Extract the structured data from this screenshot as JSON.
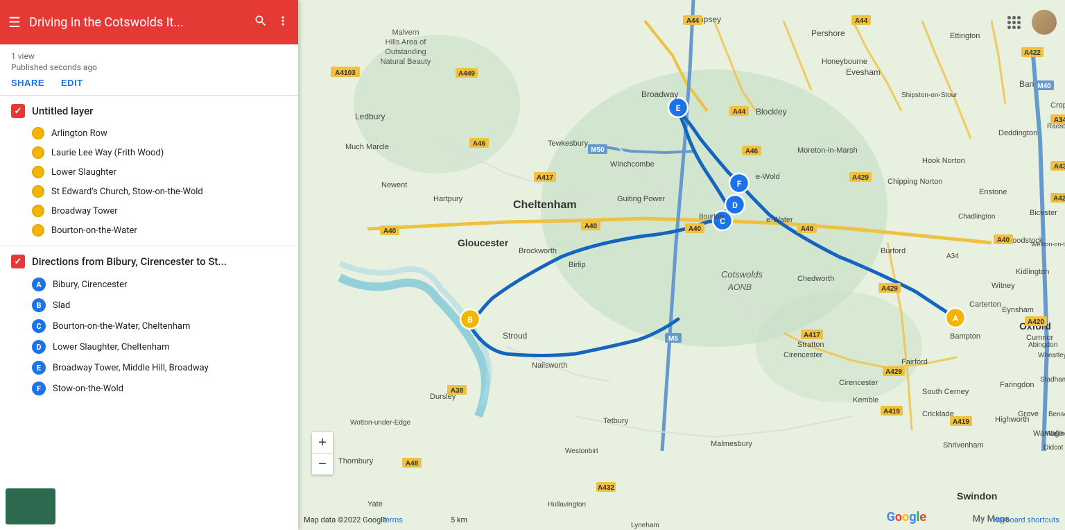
{
  "header": {
    "title": "Driving in the Cotswolds It...",
    "menu_icon": "☰",
    "search_icon": "🔍",
    "more_icon": "⋮"
  },
  "meta": {
    "views": "1 view",
    "published": "Published seconds ago",
    "share_label": "SHARE",
    "edit_label": "EDIT"
  },
  "layer": {
    "title": "Untitled layer",
    "places": [
      {
        "name": "Arlington Row"
      },
      {
        "name": "Laurie Lee Way (Frith Wood)"
      },
      {
        "name": "Lower Slaughter"
      },
      {
        "name": "St Edward's Church, Stow-on-the-Wold"
      },
      {
        "name": "Broadway Tower"
      },
      {
        "name": "Bourton-on-the-Water"
      }
    ]
  },
  "directions": {
    "title": "Directions from Bibury, Cirencester to St...",
    "waypoints": [
      {
        "label": "A",
        "name": "Bibury, Cirencester"
      },
      {
        "label": "B",
        "name": "Slad"
      },
      {
        "label": "C",
        "name": "Bourton-on-the-Water, Cheltenham"
      },
      {
        "label": "D",
        "name": "Lower Slaughter, Cheltenham"
      },
      {
        "label": "E",
        "name": "Broadway Tower, Middle Hill, Broadway"
      },
      {
        "label": "F",
        "name": "Stow-on-the-Wold"
      }
    ]
  },
  "map": {
    "footer_text": "Map data ©2022 Google",
    "terms_label": "Terms",
    "scale_label": "5 km",
    "keyboard_label": "Keyboard shortcuts",
    "google_text": "Google",
    "my_maps_text": "My Maps"
  },
  "zoom": {
    "in_label": "+",
    "out_label": "−"
  }
}
